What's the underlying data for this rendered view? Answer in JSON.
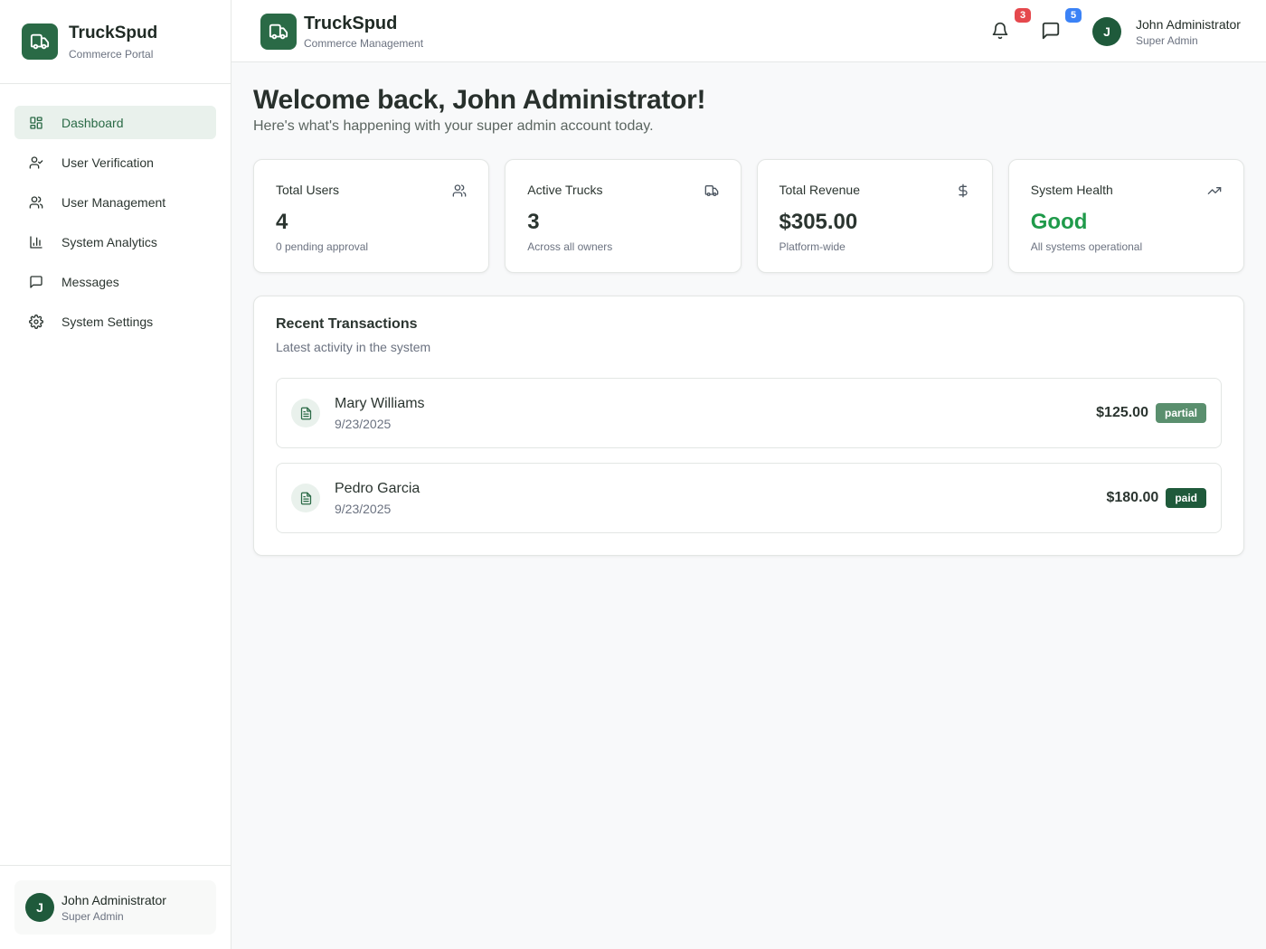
{
  "sidebar": {
    "brand": {
      "title": "TruckSpud",
      "subtitle": "Commerce Portal"
    },
    "nav": [
      {
        "label": "Dashboard",
        "icon": "dashboard-icon",
        "active": true
      },
      {
        "label": "User Verification",
        "icon": "user-check-icon",
        "active": false
      },
      {
        "label": "User Management",
        "icon": "users-icon",
        "active": false
      },
      {
        "label": "System Analytics",
        "icon": "bar-chart-icon",
        "active": false
      },
      {
        "label": "Messages",
        "icon": "message-icon",
        "active": false
      },
      {
        "label": "System Settings",
        "icon": "gear-icon",
        "active": false
      }
    ],
    "user": {
      "initial": "J",
      "name": "John Administrator",
      "role": "Super Admin"
    }
  },
  "header": {
    "brand": {
      "title": "TruckSpud",
      "subtitle": "Commerce Management"
    },
    "notifications": {
      "icon": "bell-icon",
      "count": "3",
      "color": "#e5484d"
    },
    "messages": {
      "icon": "message-icon",
      "count": "5",
      "color": "#3b82f6"
    },
    "user": {
      "initial": "J",
      "name": "John Administrator",
      "role": "Super Admin"
    }
  },
  "main": {
    "welcome": "Welcome back, John Administrator!",
    "subtitle": "Here's what's happening with your super admin account today.",
    "stats": [
      {
        "title": "Total Users",
        "value": "4",
        "note": "0 pending approval",
        "icon": "users-icon"
      },
      {
        "title": "Active Trucks",
        "value": "3",
        "note": "Across all owners",
        "icon": "truck-icon"
      },
      {
        "title": "Total Revenue",
        "value": "$305.00",
        "note": "Platform-wide",
        "icon": "dollar-icon"
      },
      {
        "title": "System Health",
        "value": "Good",
        "note": "All systems operational",
        "icon": "trending-up-icon"
      }
    ],
    "transactions": {
      "title": "Recent Transactions",
      "subtitle": "Latest activity in the system",
      "items": [
        {
          "name": "Mary Williams",
          "date": "9/23/2025",
          "amount": "$125.00",
          "status": "partial",
          "status_color": "#5a8f6e"
        },
        {
          "name": "Pedro Garcia",
          "date": "9/23/2025",
          "amount": "$180.00",
          "status": "paid",
          "status_color": "#1f5a3b"
        }
      ]
    }
  },
  "colors": {
    "brand": "#2a6a46",
    "active_bg": "#e9f1ec",
    "health_good": "#1f9a4a"
  }
}
